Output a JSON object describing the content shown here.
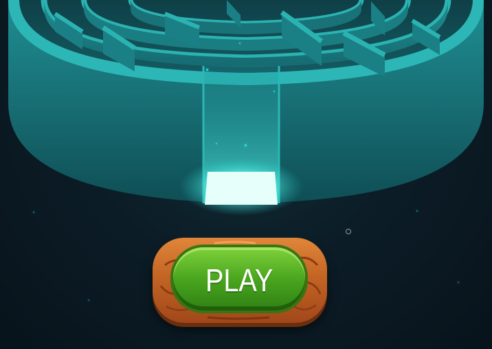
{
  "game": {
    "scene": "maze",
    "play_button": {
      "label": "PLAY"
    }
  },
  "colors": {
    "background": "#0b1822",
    "maze_wall": "#1d8c8f",
    "maze_top": "#2bb5b5",
    "glow": "#9ffff5",
    "button_green": "#4aa61f",
    "button_wood": "#c46524"
  },
  "icons": [
    "glowing-exit-tile",
    "loading-ring-icon"
  ]
}
